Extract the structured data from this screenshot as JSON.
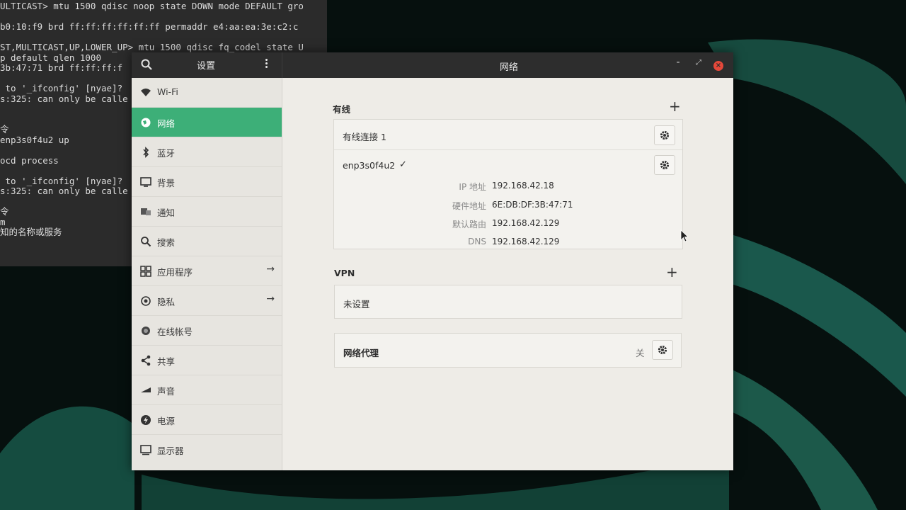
{
  "terminal": {
    "lines": [
      "ULTICAST> mtu 1500 qdisc noop state DOWN mode DEFAULT gro",
      "",
      "b0:10:f9 brd ff:ff:ff:ff:ff:ff permaddr e4:aa:ea:3e:c2:c",
      "",
      "ST,MULTICAST,UP,LOWER_UP> mtu 1500 qdisc fq_codel state U",
      "p default qlen 1000",
      "3b:47:71 brd ff:ff:ff:f",
      "",
      " to '_ifconfig' [nyae]?",
      "s:325: can only be calle",
      "",
      "",
      "令",
      "enp3s0f4u2 up",
      "",
      "ocd process",
      "",
      " to '_ifconfig' [nyae]?",
      "s:325: can only be calle",
      "",
      "令",
      "m",
      "知的名称或服务"
    ]
  },
  "window": {
    "left_title": "设置",
    "title": "网络",
    "controls": {
      "minimize": "-",
      "maximize": "⤢",
      "close": "×"
    }
  },
  "sidebar": {
    "items": [
      {
        "label": "Wi-Fi",
        "icon": "wifi-icon",
        "active": false
      },
      {
        "label": "网络",
        "icon": "network-icon",
        "active": true
      },
      {
        "label": "蓝牙",
        "icon": "bluetooth-icon",
        "active": false
      },
      {
        "label": "背景",
        "icon": "background-icon",
        "active": false
      },
      {
        "label": "通知",
        "icon": "notification-icon",
        "active": false
      },
      {
        "label": "搜索",
        "icon": "search-icon",
        "active": false
      },
      {
        "label": "应用程序",
        "icon": "apps-icon",
        "active": false,
        "arrow": "→"
      },
      {
        "label": "隐私",
        "icon": "privacy-icon",
        "active": false,
        "arrow": "→"
      },
      {
        "label": "在线帐号",
        "icon": "online-accounts-icon",
        "active": false
      },
      {
        "label": "共享",
        "icon": "share-icon",
        "active": false
      },
      {
        "label": "声音",
        "icon": "sound-icon",
        "active": false
      },
      {
        "label": "电源",
        "icon": "power-icon",
        "active": false
      },
      {
        "label": "显示器",
        "icon": "display-icon",
        "active": false
      }
    ]
  },
  "wired": {
    "title": "有线",
    "add": "+",
    "connection_name": "有线连接 1",
    "device": "enp3s0f4u2",
    "device_check": "✓",
    "details": [
      {
        "label": "IP 地址",
        "value": "192.168.42.18"
      },
      {
        "label": "硬件地址",
        "value": "6E:DB:DF:3B:47:71"
      },
      {
        "label": "默认路由",
        "value": "192.168.42.129"
      },
      {
        "label": "DNS",
        "value": "192.168.42.129"
      }
    ]
  },
  "vpn": {
    "title": "VPN",
    "add": "+",
    "status": "未设置"
  },
  "proxy": {
    "title": "网络代理",
    "state": "关"
  },
  "colors": {
    "accent": "#3daf78",
    "titlebar": "#2d2d2d",
    "close": "#e5483a"
  }
}
